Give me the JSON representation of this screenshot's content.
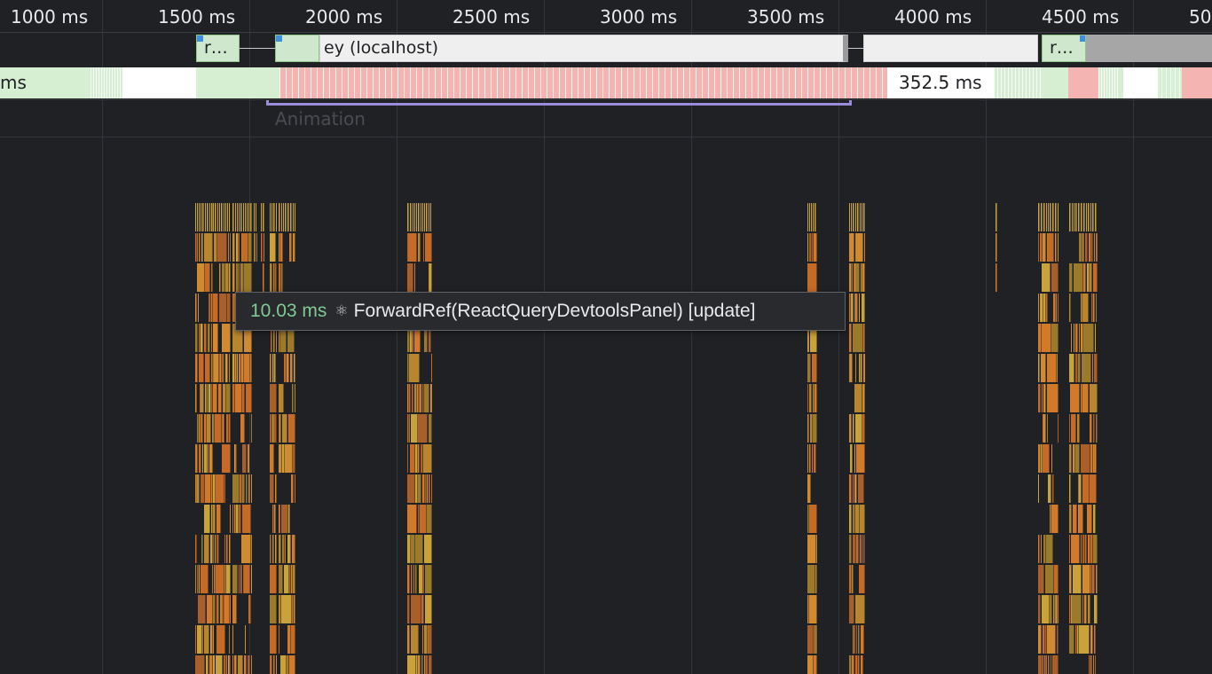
{
  "ruler": {
    "ticks": [
      "1000 ms",
      "1500 ms",
      "2000 ms",
      "2500 ms",
      "3000 ms",
      "3500 ms",
      "4000 ms",
      "4500 ms",
      "50"
    ]
  },
  "navigation": {
    "blocks": [
      {
        "label": "r…",
        "kind": "green"
      },
      {
        "label": "",
        "kind": "green"
      },
      {
        "label": "ey (localhost)",
        "kind": "main"
      },
      {
        "label": "",
        "kind": "main"
      },
      {
        "label": "r…",
        "kind": "green"
      },
      {
        "label": "",
        "kind": "grey"
      }
    ]
  },
  "frames": {
    "left_label": "ms",
    "duration_label": "352.5 ms"
  },
  "animation": {
    "label": "Animation"
  },
  "tooltip": {
    "duration": "10.03 ms",
    "react_glyph": "⚛",
    "name": "ForwardRef(ReactQueryDevtoolsPanel) [update]"
  },
  "colors": {
    "background": "#202124",
    "frame_good": "#d6efd3",
    "frame_dropped": "#f4b4b2",
    "animation_track": "#9b8cdb",
    "tooltip_duration": "#81c995",
    "flame_orange": "#d3792a",
    "flame_yellow": "#c9a23a"
  },
  "icons": {
    "react": "react-atom-icon"
  }
}
